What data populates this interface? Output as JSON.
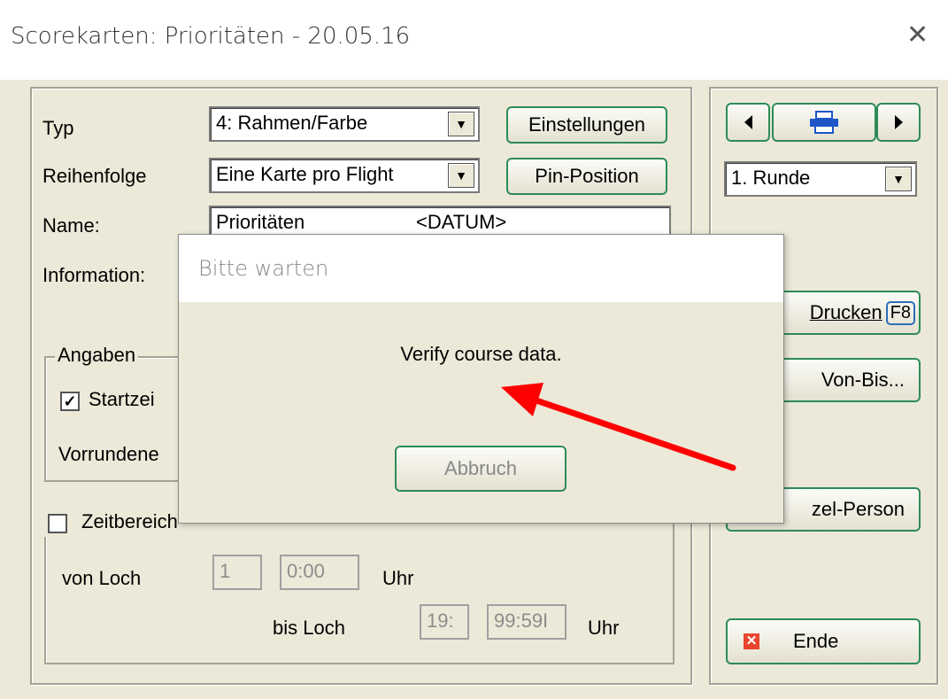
{
  "window": {
    "title": "Scorekarten: Prioritäten - 20.05.16",
    "close_glyph": "✕"
  },
  "form": {
    "typ_label": "Typ",
    "typ_value": "4: Rahmen/Farbe",
    "reihenfolge_label": "Reihenfolge",
    "reihenfolge_value": "Eine Karte pro Flight",
    "name_label": "Name:",
    "name_value": "Prioritäten",
    "name_suffix": "<DATUM>",
    "information_label": "Information:",
    "einstellungen_label": "Einstellungen",
    "pin_position_label": "Pin-Position"
  },
  "angaben": {
    "legend": "Angaben",
    "startzeit_label": "Startzei",
    "startzeit_checked": true,
    "vorrundene_label": "Vorrundene"
  },
  "zeitbereich": {
    "label": "Zeitbereich",
    "checked": false,
    "von_loch_label": "von Loch",
    "von_loch_value": "1",
    "von_zeit_value": "0:00",
    "uhr1": "Uhr",
    "bis_loch_label": "bis Loch",
    "bis_loch_value": "19:",
    "bis_zeit_value": "99:59I",
    "uhr2": "Uhr"
  },
  "right_panel": {
    "runde_value": "1. Runde",
    "drucken_label": "Drucken",
    "drucken_key": "F8",
    "von_bis_label": "Von-Bis...",
    "einzel_person_label": "zel-Person",
    "ende_label": "Ende"
  },
  "dialog": {
    "title": "Bitte warten",
    "message": "Verify course data.",
    "cancel_label": "Abbruch"
  },
  "colors": {
    "dialog_face": "#ece9d8",
    "button_border": "#2e8b57",
    "arrow": "#ff0000",
    "ende_icon": "#e8452f"
  }
}
